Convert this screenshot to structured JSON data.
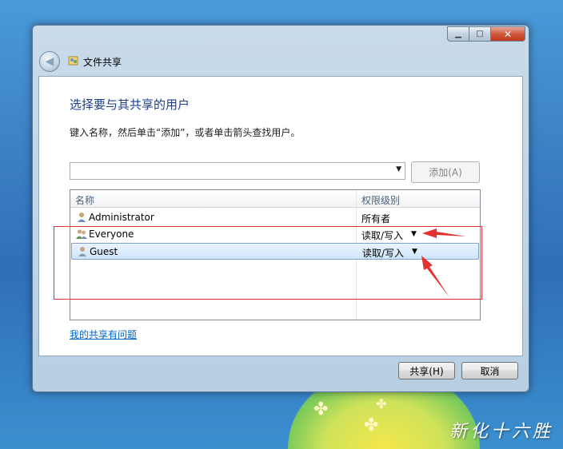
{
  "window": {
    "title": "文件共享",
    "heading": "选择要与其共享的用户",
    "instruction": "键入名称，然后单击“添加”，或者单击箭头查找用户。"
  },
  "combo": {
    "value": ""
  },
  "buttons": {
    "add": "添加(A)",
    "share": "共享(H)",
    "cancel": "取消",
    "minimize": "▁",
    "maximize": "□",
    "close": "✕",
    "back": "◀"
  },
  "list": {
    "col_name": "名称",
    "col_perm": "权限级别",
    "rows": [
      {
        "name": "Administrator",
        "perm": "所有者",
        "icon": "single-user-icon"
      },
      {
        "name": "Everyone",
        "perm": "读取/写入",
        "icon": "user-group-icon"
      },
      {
        "name": "Guest",
        "perm": "读取/写入",
        "icon": "single-user-icon",
        "selected": true
      }
    ]
  },
  "help_link": "我的共享有问题",
  "watermark": "新化十六胜",
  "colors": {
    "heading": "#1d3d8e",
    "annotation": "#e53030",
    "link": "#0066cc"
  }
}
